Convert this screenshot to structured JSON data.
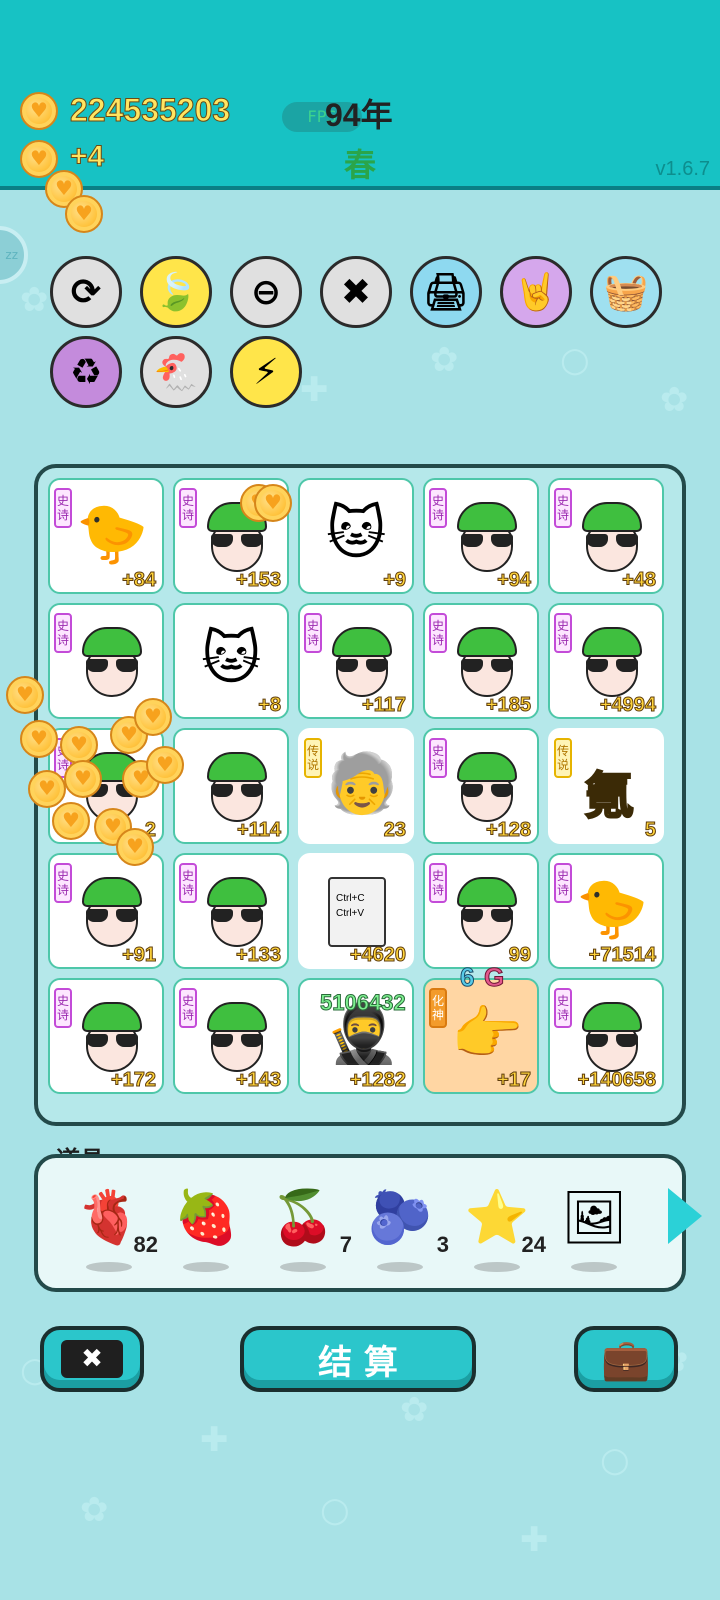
{
  "header": {
    "money": "224535203",
    "income": "+4",
    "fps_label": "FPS",
    "year": "94年",
    "season": "春",
    "version": "v1.6.7"
  },
  "skills": [
    {
      "name": "refresh-icon",
      "glyph": "⟳",
      "bg": "#e0e0e0"
    },
    {
      "name": "leaf-icon",
      "glyph": "🍃",
      "bg": "#ffe54a"
    },
    {
      "name": "minus-icon",
      "glyph": "⊖",
      "bg": "#e0e0e0"
    },
    {
      "name": "delete-icon",
      "glyph": "✖",
      "bg": "#e0e0e0"
    },
    {
      "name": "printer-icon",
      "glyph": "🖨",
      "bg": "#8ed9f0"
    },
    {
      "name": "rock-hand-icon",
      "glyph": "🤘",
      "bg": "#d5a7ec"
    },
    {
      "name": "fruit-basket-icon",
      "glyph": "🧺",
      "bg": "#9fe0f0"
    },
    {
      "name": "recycle-icon",
      "glyph": "♻",
      "bg": "#c48bdc"
    },
    {
      "name": "chicken-icon",
      "glyph": "🐔",
      "bg": "#e0e0e0"
    },
    {
      "name": "lightning-icon",
      "glyph": "⚡",
      "bg": "#ffe54a"
    }
  ],
  "tags": {
    "epic": "史诗",
    "legend": "传说",
    "god": "化神"
  },
  "cells": [
    {
      "kind": "chick",
      "tag": "epic",
      "value": "+84"
    },
    {
      "kind": "guy",
      "tag": "epic",
      "value": "+153"
    },
    {
      "kind": "cat",
      "tag": "",
      "value": "+9"
    },
    {
      "kind": "guy",
      "tag": "epic",
      "value": "+94"
    },
    {
      "kind": "guy",
      "tag": "epic",
      "value": "+48"
    },
    {
      "kind": "guy",
      "tag": "epic",
      "value": ""
    },
    {
      "kind": "cat",
      "tag": "",
      "value": "+8"
    },
    {
      "kind": "guy",
      "tag": "epic",
      "value": "+117"
    },
    {
      "kind": "guy",
      "tag": "epic",
      "value": "+185"
    },
    {
      "kind": "guy",
      "tag": "epic",
      "value": "+4994"
    },
    {
      "kind": "guy",
      "tag": "epic",
      "value": "2"
    },
    {
      "kind": "guy",
      "tag": "",
      "value": "+114"
    },
    {
      "kind": "bald",
      "tag": "legend",
      "value": "23"
    },
    {
      "kind": "guy",
      "tag": "epic",
      "value": "+128"
    },
    {
      "kind": "char",
      "tag": "legend",
      "value": "5",
      "char": "氪"
    },
    {
      "kind": "guy",
      "tag": "epic",
      "value": "+91"
    },
    {
      "kind": "guy",
      "tag": "epic",
      "value": "+133"
    },
    {
      "kind": "copy",
      "tag": "",
      "value": "+4620",
      "line1": "Ctrl+C",
      "line2": "Ctrl+V"
    },
    {
      "kind": "guy",
      "tag": "epic",
      "value": "99"
    },
    {
      "kind": "chick",
      "tag": "epic",
      "value": "+71514"
    },
    {
      "kind": "guy",
      "tag": "epic",
      "value": "+172"
    },
    {
      "kind": "guy",
      "tag": "epic",
      "value": "+143"
    },
    {
      "kind": "thief",
      "tag": "",
      "value": "+1282"
    },
    {
      "kind": "hand",
      "tag": "god",
      "value": "+17"
    },
    {
      "kind": "guy",
      "tag": "epic",
      "value": "+140658"
    }
  ],
  "floating": {
    "big_number": "5106432",
    "six": "6",
    "g": "G"
  },
  "items_title": "道具",
  "items": [
    {
      "name": "liver-icon",
      "glyph": "🫀",
      "count": "82"
    },
    {
      "name": "strawberry-icon",
      "glyph": "🍓",
      "count": ""
    },
    {
      "name": "lychee-icon",
      "glyph": "🍒",
      "count": "7"
    },
    {
      "name": "blueberry-icon",
      "glyph": "🫐",
      "count": "3"
    },
    {
      "name": "star-icon",
      "glyph": "⭐",
      "count": "24"
    },
    {
      "name": "picture-frame-icon",
      "glyph": "🖼",
      "count": ""
    }
  ],
  "buttons": {
    "left_glyph": "✖",
    "settle": "结 算",
    "right_glyph": "💼"
  }
}
